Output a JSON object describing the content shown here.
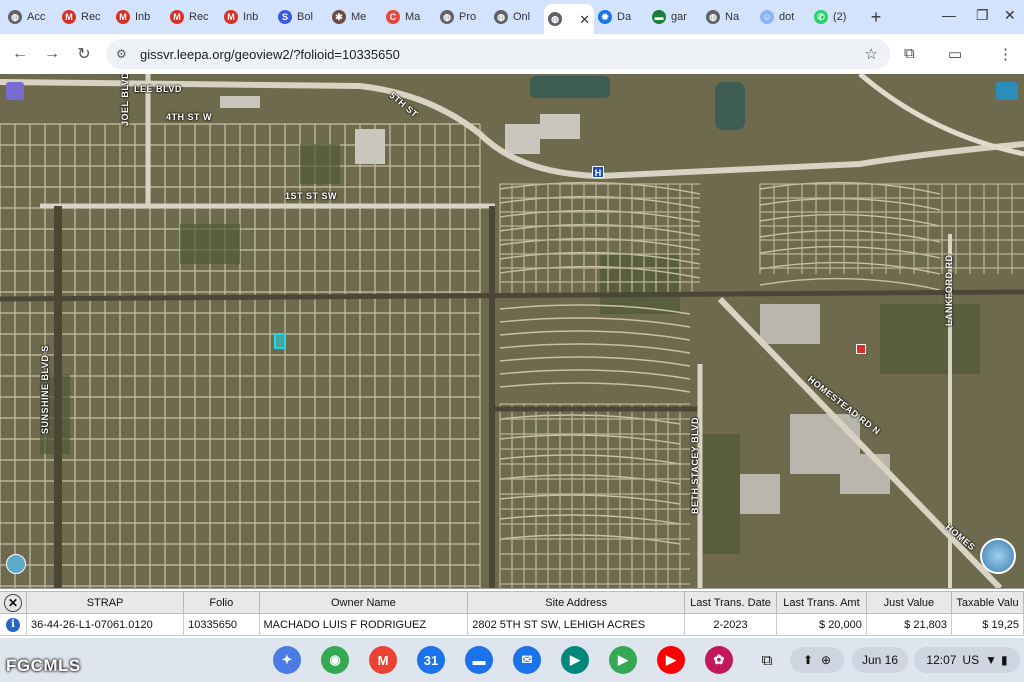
{
  "browser": {
    "tabs": [
      {
        "label": "Acc",
        "icon": "globe-icon",
        "color": "#5f6368"
      },
      {
        "label": "Rec",
        "icon": "gmail-icon",
        "color": "#d93025"
      },
      {
        "label": "Inb",
        "icon": "gmail-icon",
        "color": "#d93025"
      },
      {
        "label": "Rec",
        "icon": "gmail-icon",
        "color": "#d93025"
      },
      {
        "label": "Inb",
        "icon": "gmail-icon",
        "color": "#d93025"
      },
      {
        "label": "Bol",
        "icon": "swirl-icon",
        "color": "#3b5bdb"
      },
      {
        "label": "Me",
        "icon": "mesh-icon",
        "color": "#6d4c41"
      },
      {
        "label": "Ma",
        "icon": "c-logo-icon",
        "color": "#e8453c"
      },
      {
        "label": "Pro",
        "icon": "globe-icon",
        "color": "#5f6368"
      },
      {
        "label": "Onl",
        "icon": "globe-icon",
        "color": "#5f6368"
      },
      {
        "label": "",
        "icon": "globe-icon",
        "color": "#5f6368",
        "active": true
      },
      {
        "label": "Da",
        "icon": "gear-icon",
        "color": "#1a73e8"
      },
      {
        "label": "gar",
        "icon": "card-icon",
        "color": "#188038"
      },
      {
        "label": "Na",
        "icon": "globe-icon",
        "color": "#5f6368"
      },
      {
        "label": "dot",
        "icon": "smiley-icon",
        "color": "#8ab4f8"
      },
      {
        "label": "(2)",
        "icon": "whatsapp-icon",
        "color": "#25d366"
      }
    ],
    "new_tab": "+",
    "url": "gissvr.leepa.org/geoview2/?folioid=10335650"
  },
  "map": {
    "labels": {
      "lee_blvd": "LEE BLVD",
      "fourth_st": "4TH ST W",
      "first_st": "1ST ST SW",
      "joel_blvd": "JOEL BLVD",
      "sunshine_blvd": "SUNSHINE BLVD S",
      "beth_stacey": "BETH STACEY BLVD",
      "homestead": "HOMESTEAD RD N",
      "lankford": "LANKFORD RD",
      "fifth_st": "5TH ST",
      "homes": "HOMES",
      "hospital": "H"
    },
    "selected_parcel_color": "#25d6e6"
  },
  "results": {
    "columns": [
      "STRAP",
      "Folio",
      "Owner Name",
      "Site Address",
      "Last Trans. Date",
      "Last Trans. Amt",
      "Just Value",
      "Taxable Valu"
    ],
    "row": [
      "36-44-26-L1-07061.0120",
      "10335650",
      "MACHADO LUIS F RODRIGUEZ",
      "2802 5TH ST SW, LEHIGH ACRES",
      "2-2023",
      "$ 20,000",
      "$ 21,803",
      "$ 19,25"
    ]
  },
  "taskbar": {
    "apps": [
      {
        "name": "gemini-icon",
        "glyph": "✦",
        "color": "#4b7be5"
      },
      {
        "name": "chrome-icon",
        "glyph": "◉",
        "color": "#34a853"
      },
      {
        "name": "gmail-icon",
        "glyph": "M",
        "color": "#ea4335"
      },
      {
        "name": "calendar-icon",
        "glyph": "31",
        "color": "#1a73e8"
      },
      {
        "name": "files-icon",
        "glyph": "▬",
        "color": "#1a73e8"
      },
      {
        "name": "messages-icon",
        "glyph": "✉",
        "color": "#1a73e8"
      },
      {
        "name": "meet-icon",
        "glyph": "▶",
        "color": "#00897b"
      },
      {
        "name": "play-store-icon",
        "glyph": "▶",
        "color": "#34a853"
      },
      {
        "name": "youtube-icon",
        "glyph": "▶",
        "color": "#ff0000"
      },
      {
        "name": "photos-icon",
        "glyph": "✿",
        "color": "#c2185b"
      }
    ],
    "date": "Jun 16",
    "time": "12:07",
    "locale": "US"
  },
  "watermark": "FGCMLS"
}
